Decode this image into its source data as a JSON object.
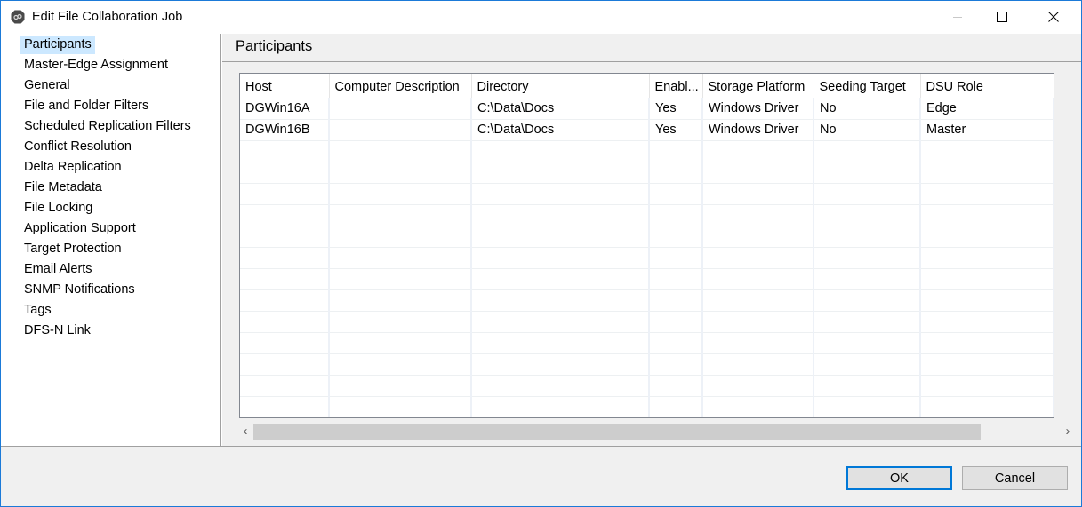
{
  "window": {
    "title": "Edit File Collaboration Job",
    "app_icon": "peer-link-icon",
    "controls": {
      "minimize": "minimize-icon",
      "maximize": "maximize-icon",
      "close": "close-icon"
    },
    "accent_color": "#1b7ad8"
  },
  "sidebar": {
    "selected_index": 0,
    "items": [
      {
        "label": "Participants"
      },
      {
        "label": "Master-Edge Assignment"
      },
      {
        "label": "General"
      },
      {
        "label": "File and Folder Filters"
      },
      {
        "label": "Scheduled Replication Filters"
      },
      {
        "label": "Conflict Resolution"
      },
      {
        "label": "Delta Replication"
      },
      {
        "label": "File Metadata"
      },
      {
        "label": "File Locking"
      },
      {
        "label": "Application Support"
      },
      {
        "label": "Target Protection"
      },
      {
        "label": "Email Alerts"
      },
      {
        "label": "SNMP Notifications"
      },
      {
        "label": "Tags"
      },
      {
        "label": "DFS-N Link"
      }
    ],
    "selected_color": "#cce8ff"
  },
  "main": {
    "title": "Participants",
    "table": {
      "columns": [
        "Host",
        "Computer Description",
        "Directory",
        "Enabl...",
        "Storage Platform",
        "Seeding Target",
        "DSU Role",
        ""
      ],
      "rows": [
        [
          "DGWin16A",
          "",
          "C:\\Data\\Docs",
          "Yes",
          "Windows Driver",
          "No",
          "Edge",
          ""
        ],
        [
          "DGWin16B",
          "",
          "C:\\Data\\Docs",
          "Yes",
          "Windows Driver",
          "No",
          "Master",
          ""
        ]
      ],
      "empty_rows": 13
    },
    "scrollbar": {
      "left_arrow": "‹",
      "right_arrow": "›"
    }
  },
  "footer": {
    "ok_label": "OK",
    "cancel_label": "Cancel"
  }
}
